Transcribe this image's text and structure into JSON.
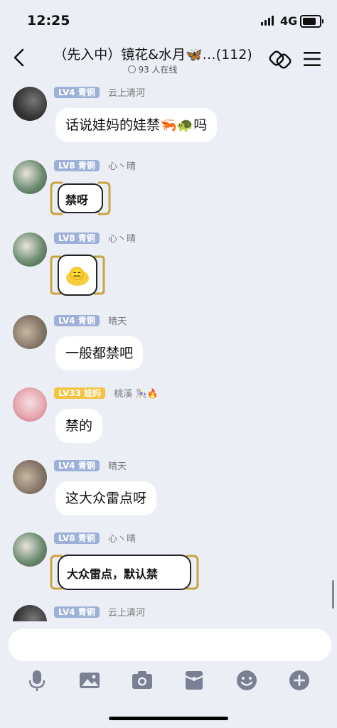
{
  "status_bar": {
    "time": "12:25",
    "network": "4G"
  },
  "header": {
    "title": "（先入中）镜花&水月🦋…(112)",
    "online": "93 人在线"
  },
  "messages": [
    {
      "level": "LV4 青铜",
      "name": "云上清河",
      "text": "话说娃妈的娃禁🦐🐢吗",
      "avatar_color": "#4b4b4b"
    },
    {
      "level": "LV8 青铜",
      "name": "心丶晴",
      "sticker_text": "禁呀",
      "avatar_color": "#6f8d73"
    },
    {
      "level": "LV8 青铜",
      "name": "心丶晴",
      "sticker_emoji": "😑",
      "avatar_color": "#6f8d73"
    },
    {
      "level": "LV4 青铜",
      "name": "晴天",
      "text": "一般都禁吧",
      "avatar_color": "#8a7b6c"
    },
    {
      "level": "LV33 娃妈",
      "name": "桃溪 🎠🔥",
      "text": "禁的",
      "avatar_color": "#e7a9b2"
    },
    {
      "level": "LV4 青铜",
      "name": "晴天",
      "text": "这大众雷点呀",
      "avatar_color": "#8a7b6c"
    },
    {
      "level": "LV8 青铜",
      "name": "心丶晴",
      "sticker_text": "大众雷点，默认禁",
      "avatar_color": "#6f8d73"
    },
    {
      "level": "LV4 青铜",
      "name": "云上清河",
      "avatar_color": "#4b4b4b"
    }
  ],
  "input": {
    "placeholder": ""
  },
  "toolbar": [
    "microphone-icon",
    "image-icon",
    "camera-icon",
    "red-packet-icon",
    "emoji-icon",
    "plus-icon"
  ]
}
